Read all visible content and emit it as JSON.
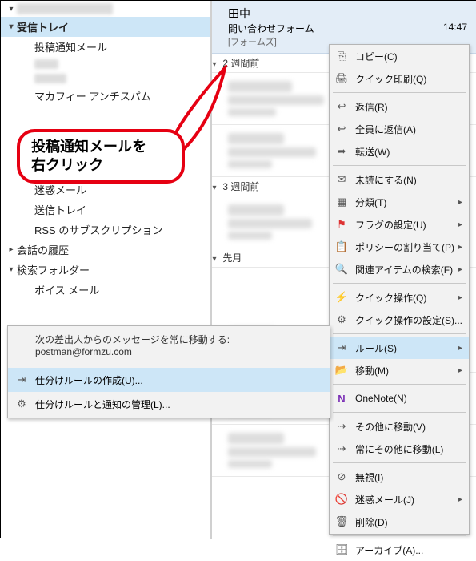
{
  "tree": {
    "topBlur": "　　　　　　",
    "inbox": "受信トレイ",
    "postNotify": "投稿通知メール",
    "mcafee": "マカフィー  アンチスパム",
    "spam": "迷惑メール",
    "sent": "送信トレイ",
    "rss": "RSS のサブスクリプション",
    "convHist": "会話の履歴",
    "searchFolders": "検索フォルダー",
    "voiceMail": "ボイス メール"
  },
  "callout": "投稿通知メールを\n右クリック",
  "msg": {
    "sender": "田中",
    "subject": "問い合わせフォーム",
    "time": "14:47",
    "category": "[フォームズ]",
    "group2w": "2 週間前",
    "group3w": "3 週間前",
    "groupPrevMonth": "先月"
  },
  "ctx": {
    "copy": "コピー(C)",
    "quickprint": "クイック印刷(Q)",
    "reply": "返信(R)",
    "replyall": "全員に返信(A)",
    "forward": "転送(W)",
    "markunread": "未読にする(N)",
    "categorize": "分類(T)",
    "flag": "フラグの設定(U)",
    "policy": "ポリシーの割り当て(P)",
    "related": "関連アイテムの検索(F)",
    "quickop": "クイック操作(Q)",
    "quickopset": "クイック操作の設定(S)...",
    "rules": "ルール(S)",
    "move": "移動(M)",
    "onenote": "OneNote(N)",
    "moveother": "その他に移動(V)",
    "alwaysother": "常にその他に移動(L)",
    "ignore": "無視(I)",
    "junk": "迷惑メール(J)",
    "delete": "削除(D)",
    "archive": "アーカイブ(A)..."
  },
  "sub": {
    "static": "次の差出人からのメッセージを常に移動する: postman@formzu.com",
    "createRule": "仕分けルールの作成(U)...",
    "manageRules": "仕分けルールと通知の管理(L)..."
  }
}
